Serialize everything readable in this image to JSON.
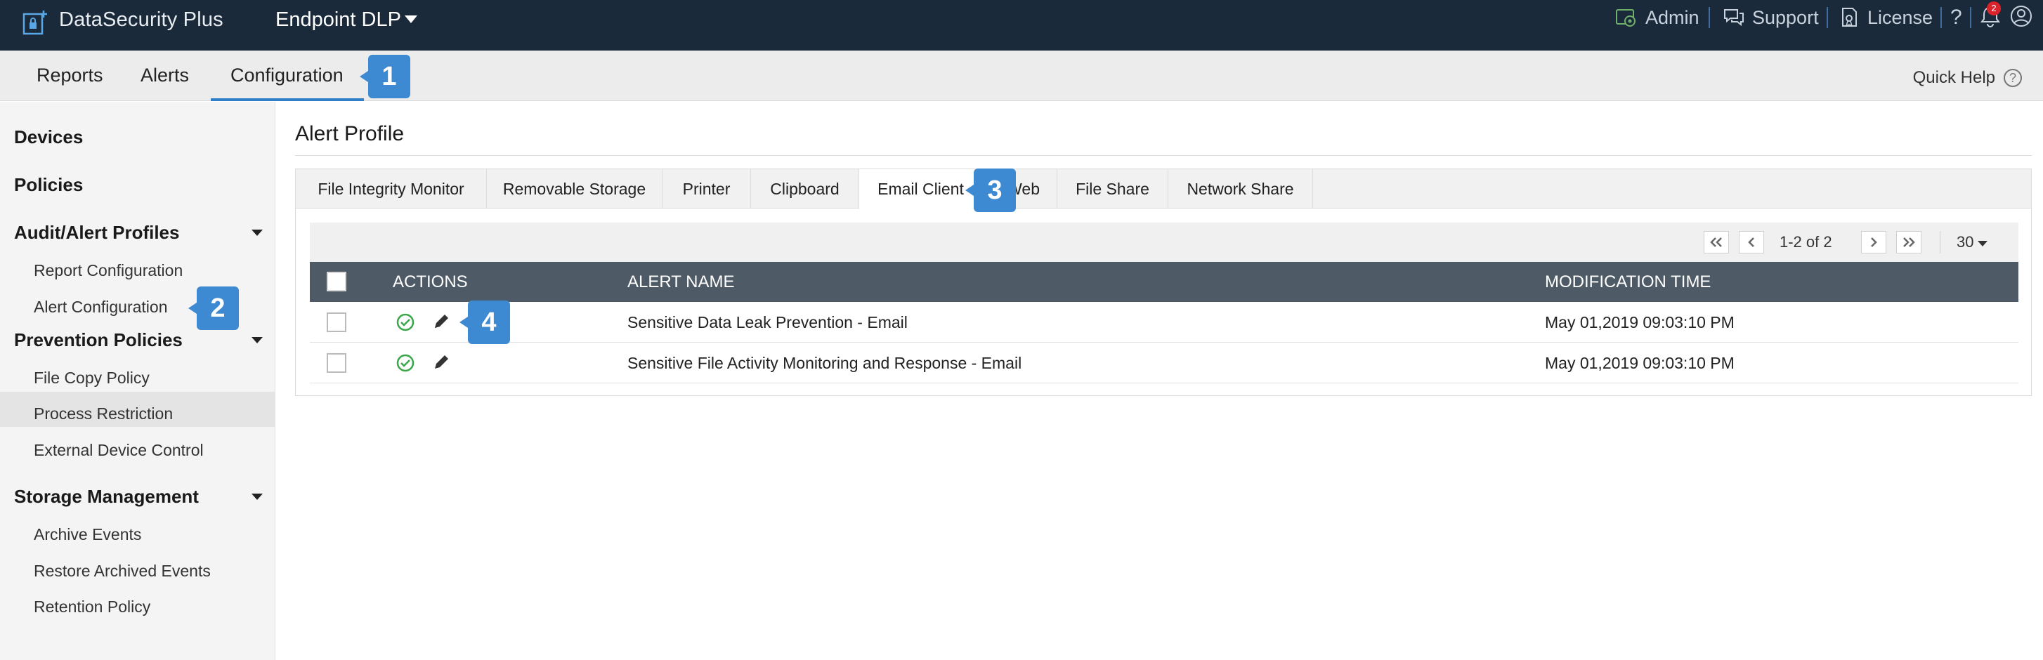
{
  "app": {
    "brand": "DataSecurity Plus",
    "product": "Endpoint DLP"
  },
  "top_links": {
    "admin": "Admin",
    "support": "Support",
    "license": "License",
    "help": "?",
    "notification_count": "2"
  },
  "nav": {
    "tabs": [
      {
        "label": "Reports"
      },
      {
        "label": "Alerts"
      },
      {
        "label": "Configuration"
      }
    ],
    "active_tab": "Configuration",
    "quick_help": "Quick Help",
    "quick_help_icon": "?"
  },
  "sidebar": {
    "devices": "Devices",
    "policies": "Policies",
    "audit_alert_profiles": "Audit/Alert Profiles",
    "report_configuration": "Report Configuration",
    "alert_configuration": "Alert Configuration",
    "prevention_policies": "Prevention Policies",
    "file_copy_policy": "File Copy Policy",
    "process_restriction": "Process Restriction",
    "external_device_control": "External Device Control",
    "storage_management": "Storage Management",
    "archive_events": "Archive Events",
    "restore_archived_events": "Restore Archived Events",
    "retention_policy": "Retention Policy"
  },
  "main": {
    "title": "Alert Profile",
    "subtabs": [
      "File Integrity Monitor",
      "Removable Storage",
      "Printer",
      "Clipboard",
      "Email Client",
      "Web",
      "File Share",
      "Network Share"
    ],
    "active_subtab": "Email Client",
    "pager": {
      "range": "1-2 of 2",
      "page_size": "30"
    },
    "table": {
      "columns": [
        "ACTIONS",
        "ALERT NAME",
        "MODIFICATION TIME"
      ],
      "rows": [
        {
          "name": "Sensitive Data Leak Prevention - Email",
          "time": "May 01,2019 09:03:10 PM"
        },
        {
          "name": "Sensitive File Activity Monitoring and Response - Email",
          "time": "May 01,2019 09:03:10 PM"
        }
      ]
    }
  },
  "callouts": [
    "1",
    "2",
    "3",
    "4"
  ],
  "colors": {
    "topbar": "#1b2a3a",
    "accent": "#2f7fc8",
    "callout": "#3d8ad2",
    "table_header": "#4e5b66",
    "enabled_green": "#3aa64a",
    "badge_red": "#d9242b"
  }
}
